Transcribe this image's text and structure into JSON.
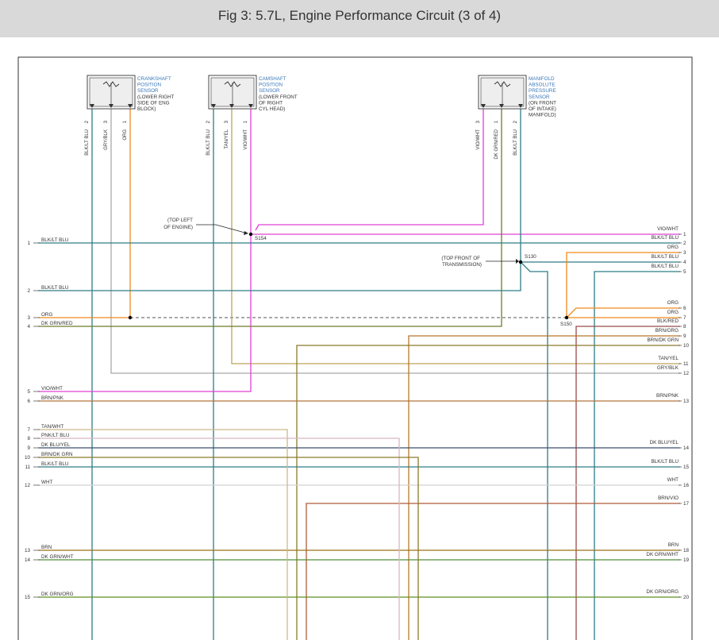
{
  "title": "Fig 3: 5.7L, Engine Performance Circuit (3 of 4)",
  "colors": {
    "BLK/LT BLU": "#2e7d86",
    "GRY/BLK": "#a9a9a9",
    "ORG": "#f08a1c",
    "TAN/YEL": "#bda35a",
    "VIO/WHT": "#e040d8",
    "DK GRN/RED": "#6c7c28",
    "BLK/RED": "#9a4a4a",
    "BRN/ORG": "#b8762a",
    "BRN/DK GRN": "#8c7a2a",
    "BRN/PNK": "#b5743e",
    "TAN/WHT": "#c9b98a",
    "PNK/LT BLU": "#d7b6c4",
    "DK BLU/YEL": "#3b4f6c",
    "WHT": "#d4d4d4",
    "BRN/VIO": "#b05a3a",
    "BRN": "#9a7018",
    "DK GRN/WHT": "#4f8f3a",
    "DK GRN/ORG": "#5f8f20"
  },
  "components": [
    {
      "id": "ckp",
      "label_lines": [
        "CRANKSHAFT",
        "POSITION",
        "SENSOR"
      ],
      "note_lines": [
        "(LOWER RIGHT",
        "SIDE OF ENG",
        "BLOCK)"
      ],
      "pins": [
        {
          "num": "2",
          "wire": "BLK/LT BLU"
        },
        {
          "num": "3",
          "wire": "GRY/BLK"
        },
        {
          "num": "1",
          "wire": "ORG"
        }
      ]
    },
    {
      "id": "cmp",
      "label_lines": [
        "CAMSHAFT",
        "POSITION",
        "SENSOR"
      ],
      "note_lines": [
        "(LOWER FRONT",
        "OF RIGHT",
        "CYL HEAD)"
      ],
      "pins": [
        {
          "num": "2",
          "wire": "BLK/LT BLU"
        },
        {
          "num": "3",
          "wire": "TAN/YEL"
        },
        {
          "num": "1",
          "wire": "VIO/WHT"
        }
      ]
    },
    {
      "id": "map",
      "label_lines": [
        "MANIFOLD",
        "ABSOLUTE",
        "PRESSURE",
        "SENSOR"
      ],
      "note_lines": [
        "(ON FRONT",
        "OF INTAKE)",
        "MANIFOLD)"
      ],
      "pins": [
        {
          "num": "3",
          "wire": "VIO/WHT"
        },
        {
          "num": "1",
          "wire": "DK GRN/RED"
        },
        {
          "num": "2",
          "wire": "BLK/LT BLU"
        }
      ]
    }
  ],
  "splices": [
    {
      "id": "S154",
      "note_lines": [
        "(TOP LEFT",
        "OF ENGINE)"
      ]
    },
    {
      "id": "S130",
      "note_lines": [
        "(TOP FRONT OF",
        "TRANSMISSION)"
      ]
    },
    {
      "id": "S150",
      "note_lines": []
    }
  ],
  "left_pins": [
    {
      "num": "1",
      "label": "BLK/LT BLU"
    },
    {
      "num": "2",
      "label": "BLK/LT BLU"
    },
    {
      "num": "3",
      "label": "ORG"
    },
    {
      "num": "4",
      "label": "DK GRN/RED"
    },
    {
      "num": "5",
      "label": "VIO/WHT"
    },
    {
      "num": "6",
      "label": "BRN/PNK"
    },
    {
      "num": "7",
      "label": "TAN/WHT"
    },
    {
      "num": "8",
      "label": "PNK/LT BLU"
    },
    {
      "num": "9",
      "label": "DK BLU/YEL"
    },
    {
      "num": "10",
      "label": "BRN/DK GRN"
    },
    {
      "num": "11",
      "label": "BLK/LT BLU"
    },
    {
      "num": "12",
      "label": "WHT"
    },
    {
      "num": "13",
      "label": "BRN"
    },
    {
      "num": "14",
      "label": "DK GRN/WHT"
    },
    {
      "num": "15",
      "label": "DK GRN/ORG"
    }
  ],
  "right_pins": [
    {
      "num": "1",
      "label": "VIO/WHT"
    },
    {
      "num": "2",
      "label": "BLK/LT BLU"
    },
    {
      "num": "3",
      "label": "ORG"
    },
    {
      "num": "4",
      "label": "BLK/LT BLU"
    },
    {
      "num": "5",
      "label": "BLK/LT BLU"
    },
    {
      "num": "6",
      "label": "ORG"
    },
    {
      "num": "7",
      "label": "ORG"
    },
    {
      "num": "8",
      "label": "BLK/RED"
    },
    {
      "num": "9",
      "label": "BRN/ORG"
    },
    {
      "num": "10",
      "label": "BRN/DK GRN"
    },
    {
      "num": "11",
      "label": "TAN/YEL"
    },
    {
      "num": "12",
      "label": "GRY/BLK"
    },
    {
      "num": "13",
      "label": "BRN/PNK"
    },
    {
      "num": "14",
      "label": "DK BLU/YEL"
    },
    {
      "num": "15",
      "label": "BLK/LT BLU"
    },
    {
      "num": "16",
      "label": "WHT"
    },
    {
      "num": "17",
      "label": "BRN/VIO"
    },
    {
      "num": "18",
      "label": "BRN"
    },
    {
      "num": "19",
      "label": "DK GRN/WHT"
    },
    {
      "num": "20",
      "label": "DK GRN/ORG"
    }
  ]
}
